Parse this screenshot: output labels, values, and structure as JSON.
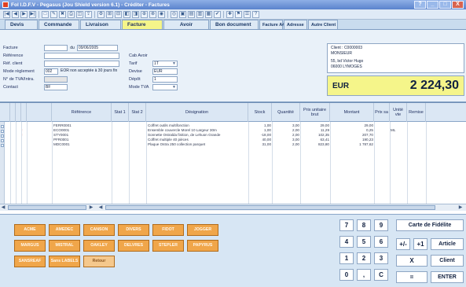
{
  "window": {
    "title": "Fol I.D.F.V - Pegasus (Jou Shield version 6.1) - Créditer - Factures",
    "buttons": [
      "?",
      "_",
      "□",
      "X"
    ]
  },
  "toolbar": {
    "icons": [
      "first-icon",
      "prev-icon",
      "next-icon",
      "last-icon",
      "new-icon",
      "edit-icon",
      "delete-icon",
      "print-icon",
      "preview-icon",
      "export-icon",
      "tool-icon",
      "tool-icon",
      "tool-icon",
      "tool-icon",
      "tool-icon",
      "tool-icon",
      "tool-icon",
      "tool-icon",
      "tool-icon",
      "tool-icon",
      "tool-icon",
      "tool-icon",
      "tool-icon",
      "tool-icon",
      "tool-icon",
      "tool-icon",
      "tool-icon",
      "help-icon"
    ]
  },
  "tabs": [
    {
      "label": "Devis"
    },
    {
      "label": "Commande"
    },
    {
      "label": "Livraison"
    },
    {
      "label": "Facture"
    },
    {
      "label": "Avoir"
    },
    {
      "label": "Bon document"
    },
    {
      "label": "Facture A4"
    },
    {
      "label": "Adresse"
    },
    {
      "label": "Autre Client"
    }
  ],
  "form": {
    "facture": {
      "label": "Facture",
      "value": "",
      "suffix": "du",
      "date": "09/06/2005"
    },
    "reference": {
      "label": "Référence",
      "value": ""
    },
    "ref_client": {
      "label": "Réf. client",
      "value": ""
    },
    "reglement": {
      "label": "Mode règlement",
      "code": "002",
      "text": "EOR non acceptée à 30 jours fin"
    },
    "nom_commercial": {
      "label": "N° de TVA/Intra.",
      "value": ""
    },
    "contact": {
      "label": "Contact",
      "value": "BF"
    },
    "cab_avoir": {
      "label": "Cab Avoir",
      "value": ""
    },
    "tarif": {
      "label": "Tarif",
      "value": "1T"
    },
    "devise": {
      "label": "Devise",
      "value": "EUR"
    },
    "depot": {
      "label": "Dépôt",
      "value": "1"
    },
    "mode_tva": {
      "label": "Mode TVA",
      "value": ""
    }
  },
  "client": {
    "lines": [
      "Client : C0000003",
      "MONSIEUR",
      "",
      "55, bd Victor Hugo",
      "06000 LYMOGES"
    ]
  },
  "totals": {
    "currency": "EUR",
    "amount": "2 224,30"
  },
  "grid": {
    "columns": [
      "",
      "",
      "",
      "",
      "",
      "Référence",
      "Stat 1",
      "Stat 2",
      "Désignation",
      "Stock",
      "Quantité",
      "Prix unitaire brut",
      "Montant",
      "Prix sa",
      "Unité vte",
      "Remise"
    ],
    "rows": [
      {
        "flag": "",
        "ref": "FERR0001",
        "stat1": "",
        "stat2": "",
        "desig": "Coffret outils multifonction",
        "stock": "1,00",
        "qty": "3,00",
        "pu": "29,00",
        "montant": "29,00",
        "unit": "",
        "rem": ""
      },
      {
        "flag": "!",
        "ref": "ECO0001",
        "stat1": "",
        "stat2": "",
        "desig": "Ensemble couvercle Morel 10 Largeur 30m",
        "stock": "1,00",
        "qty": "2,00",
        "pu": "11,29",
        "montant": "0,25",
        "unit": "ML",
        "rem": ""
      },
      {
        "flag": "!",
        "ref": "STY0001",
        "stat1": "",
        "stat2": "",
        "desig": "Sonnette Ostralda finition, de Lehuon Grande",
        "stock": "-18,00",
        "qty": "2,00",
        "pu": "102,35",
        "montant": "207,70",
        "unit": "",
        "rem": ""
      },
      {
        "flag": "",
        "ref": "PFR0001",
        "stat1": "",
        "stat2": "",
        "desig": "Coffret multiple 40 pièces",
        "stock": "40,00",
        "qty": "3,00",
        "pu": "63,41",
        "montant": "190,23",
        "unit": "",
        "rem": ""
      },
      {
        "flag": "",
        "ref": "MDC0001",
        "stat1": "",
        "stat2": "",
        "desig": "Plaque Ostra 250 collection parquet",
        "stock": "31,00",
        "qty": "2,00",
        "pu": "823,80",
        "montant": "1 787,62",
        "unit": "",
        "rem": ""
      }
    ]
  },
  "article_buttons": [
    {
      "label": "ACME",
      "pale": false
    },
    {
      "label": "AMEDEC",
      "pale": false
    },
    {
      "label": "CANSON",
      "pale": false
    },
    {
      "label": "DIVERS",
      "pale": false
    },
    {
      "label": "FIDOT",
      "pale": false
    },
    {
      "label": "JOGGER",
      "pale": false
    },
    {
      "label": "MARGUS",
      "pale": false
    },
    {
      "label": "MISTRAL",
      "pale": false
    },
    {
      "label": "OAKLEY",
      "pale": false
    },
    {
      "label": "DELVRES",
      "pale": false
    },
    {
      "label": "STEPLER",
      "pale": false
    },
    {
      "label": "PAPYRUS",
      "pale": false
    },
    {
      "label": "SANSREAF",
      "pale": false
    },
    {
      "label": "Sans LABELS",
      "pale": false
    },
    {
      "label": "Retour",
      "pale": true
    }
  ],
  "keypad": {
    "keys": [
      "7",
      "8",
      "9",
      "4",
      "5",
      "6",
      "1",
      "2",
      "3",
      "0",
      ",",
      "C"
    ],
    "actions": {
      "fidelite": "Carte de Fidélite",
      "plus_minus": "+/-",
      "plus_one": "+1",
      "article": "Article",
      "multiply": "X",
      "client": "Client",
      "equals": "=",
      "enter": "ENTER"
    }
  }
}
